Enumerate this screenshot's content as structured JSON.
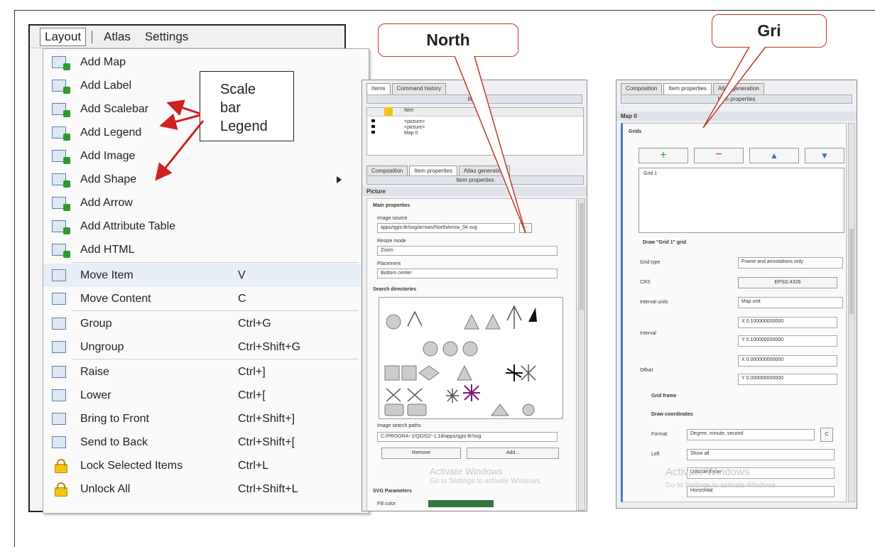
{
  "menu": {
    "bar": [
      "Layout",
      "Atlas",
      "Settings"
    ],
    "items": [
      {
        "label": "Add Map",
        "shortcut": ""
      },
      {
        "label": "Add Label",
        "shortcut": ""
      },
      {
        "label": "Add Scalebar",
        "shortcut": ""
      },
      {
        "label": "Add Legend",
        "shortcut": ""
      },
      {
        "label": "Add Image",
        "shortcut": ""
      },
      {
        "label": "Add Shape",
        "shortcut": ""
      },
      {
        "label": "Add Arrow",
        "shortcut": ""
      },
      {
        "label": "Add Attribute Table",
        "shortcut": ""
      },
      {
        "label": "Add HTML",
        "shortcut": ""
      },
      {
        "label": "Move Item",
        "shortcut": "V"
      },
      {
        "label": "Move Content",
        "shortcut": "C"
      },
      {
        "label": "Group",
        "shortcut": "Ctrl+G"
      },
      {
        "label": "Ungroup",
        "shortcut": "Ctrl+Shift+G"
      },
      {
        "label": "Raise",
        "shortcut": "Ctrl+]"
      },
      {
        "label": "Lower",
        "shortcut": "Ctrl+["
      },
      {
        "label": "Bring to Front",
        "shortcut": "Ctrl+Shift+]"
      },
      {
        "label": "Send to Back",
        "shortcut": "Ctrl+Shift+["
      },
      {
        "label": "Lock Selected Items",
        "shortcut": "Ctrl+L"
      },
      {
        "label": "Unlock All",
        "shortcut": "Ctrl+Shift+L"
      }
    ]
  },
  "callout": {
    "line1": "Scale",
    "line2": "bar",
    "line3": "Legend"
  },
  "bubbles": {
    "north": "North",
    "grid": "Gri"
  },
  "colors": {
    "arrow": "#d02020",
    "bubble_border": "#c0392b"
  },
  "panel_mid": {
    "tabs_top": [
      "Items",
      "Command history"
    ],
    "items_hdr": "Items",
    "items_cols": [
      "Item"
    ],
    "items_rows": [
      "<picture>",
      "<picture>",
      "Map 0"
    ],
    "tabs": [
      "Composition",
      "Item properties",
      "Atlas generation"
    ],
    "props_hdr": "Item properties",
    "section": "Picture",
    "main_props": "Main properties",
    "image_source_label": "Image source",
    "image_source_value": "apps/qgis-ltr/svg/arrows/NorthArrow_04.svg",
    "browse": "...",
    "resize_label": "Resize mode",
    "resize_value": "Zoom",
    "placement_label": "Placement",
    "placement_value": "Bottom center",
    "search_dirs": "Search directories",
    "search_paths_label": "Image search paths",
    "search_paths_value": "C:/PROGRA~1/QGIS2~1.18/apps/qgis-ltr/svg",
    "remove": "Remove",
    "add": "Add...",
    "svg_params": "SVG Parameters",
    "fill_color": "Fill color",
    "watermark1": "Activate Windows",
    "watermark2": "Go to Settings to activate Windows."
  },
  "panel_right": {
    "tabs": [
      "Composition",
      "Item properties",
      "Atlas generation"
    ],
    "props_hdr": "Item properties",
    "section": "Map 0",
    "grids": "Grids",
    "grid_item": "Grid 1",
    "draw_grid": "Draw \"Grid 1\" grid",
    "grid_type_label": "Grid type",
    "grid_type_value": "Frame and annotations only",
    "crs_label": "CRS",
    "crs_value": "EPSG:4326",
    "interval_units_label": "Interval units",
    "interval_units_value": "Map unit",
    "interval_label": "Interval",
    "interval_x": "X 0.100000000000",
    "interval_y": "Y 0.100000000000",
    "offset_label": "Offset",
    "offset_x": "X 0.000000000000",
    "offset_y": "Y 0.000000000000",
    "grid_frame": "Grid frame",
    "draw_coords": "Draw coordinates",
    "format_label": "Format",
    "format_value": "Degree, minute, second",
    "left_label": "Left",
    "left_value": "Show all",
    "outside_value": "Outside frame",
    "horizontal_value": "Horizontal",
    "watermark1": "Activate Windows",
    "watermark2": "Go to Settings to activate Windows."
  }
}
